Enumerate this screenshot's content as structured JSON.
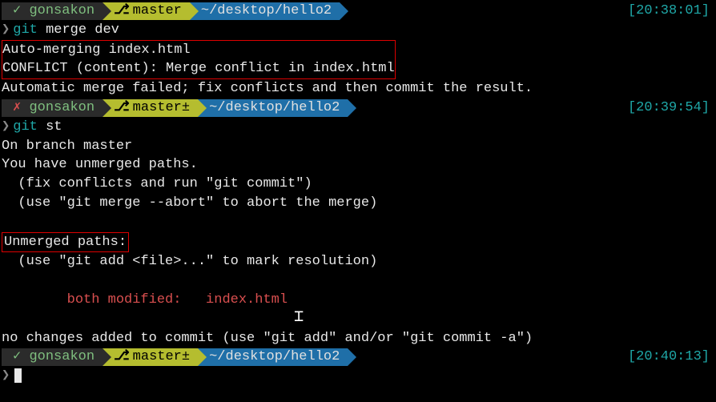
{
  "p1": {
    "user_mark": "✓",
    "user": "gonsakon",
    "branch_icon": "⎇",
    "branch": "master",
    "path": "~/desktop/hello2",
    "time": "[20:38:01]"
  },
  "cmd1": {
    "arrow": "❯",
    "c": "git",
    "a": "merge dev"
  },
  "out1": {
    "l1": "Auto-merging index.html",
    "l2": "CONFLICT (content): Merge conflict in index.html",
    "l3": "Automatic merge failed; fix conflicts and then commit the result."
  },
  "p2": {
    "user_mark": "✗",
    "user": "gonsakon",
    "branch_icon": "⎇",
    "branch": "master±",
    "path": "~/desktop/hello2",
    "time": "[20:39:54]"
  },
  "cmd2": {
    "arrow": "❯",
    "c": "git",
    "a": "st"
  },
  "out2": {
    "l1": "On branch master",
    "l2": "You have unmerged paths.",
    "l3": "  (fix conflicts and run \"git commit\")",
    "l4": "  (use \"git merge --abort\" to abort the merge)",
    "l5": "Unmerged paths:",
    "l6": "  (use \"git add <file>...\" to mark resolution)",
    "l7": "        both modified:   index.html",
    "l8": "no changes added to commit (use \"git add\" and/or \"git commit -a\")"
  },
  "p3": {
    "user_mark": "✓",
    "user": "gonsakon",
    "branch_icon": "⎇",
    "branch": "master±",
    "path": "~/desktop/hello2",
    "time": "[20:40:13]"
  },
  "cmd3": {
    "arrow": "❯"
  },
  "cursor_ibeam": "I"
}
